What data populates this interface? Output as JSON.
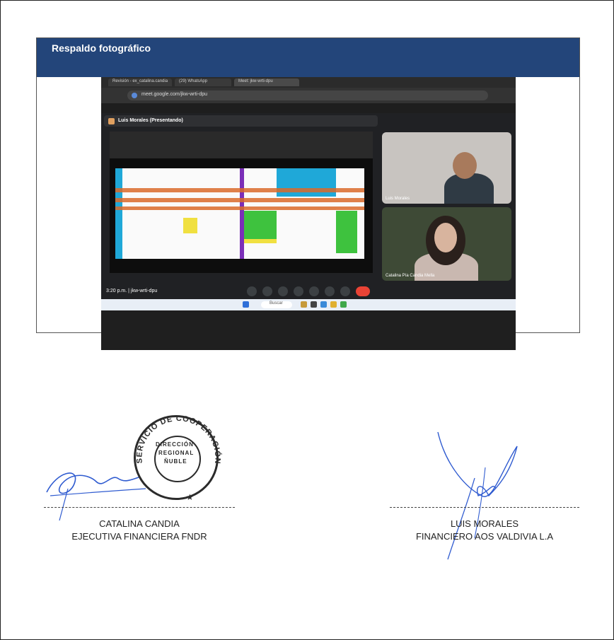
{
  "section": {
    "title": "Respaldo fotográfico"
  },
  "screenshot": {
    "url": "meet.google.com/jkw-wrti-dpu",
    "tabs": [
      "Revisión - ex_catalina.candia",
      "(29) WhatsApp",
      "Meet: jkw-wrti-dpu"
    ],
    "presenter": "Luis Morales (Presentando)",
    "participants": [
      "Luis Morales",
      "Catalina Pía Candia Mella"
    ],
    "clock": "3:20 p.m. | jkw-wrti-dpu",
    "search_placeholder": "Buscar"
  },
  "stamp": {
    "ring_text": "SERVICIO DE COOPERACIÓN TÉCNICA",
    "center_lines": [
      "DIRECCIÓN",
      "REGIONAL",
      "ÑUBLE"
    ]
  },
  "signatures": [
    {
      "name": "CATALINA CANDIA",
      "role": "EJECUTIVA FINANCIERA FNDR"
    },
    {
      "name": "LUIS MORALES",
      "role": "FINANCIERO AOS VALDIVIA L.A"
    }
  ],
  "colors": {
    "header_band": "#23457a",
    "sheet_highlight": "#d96a2a",
    "ink": "#2f5bd0"
  }
}
